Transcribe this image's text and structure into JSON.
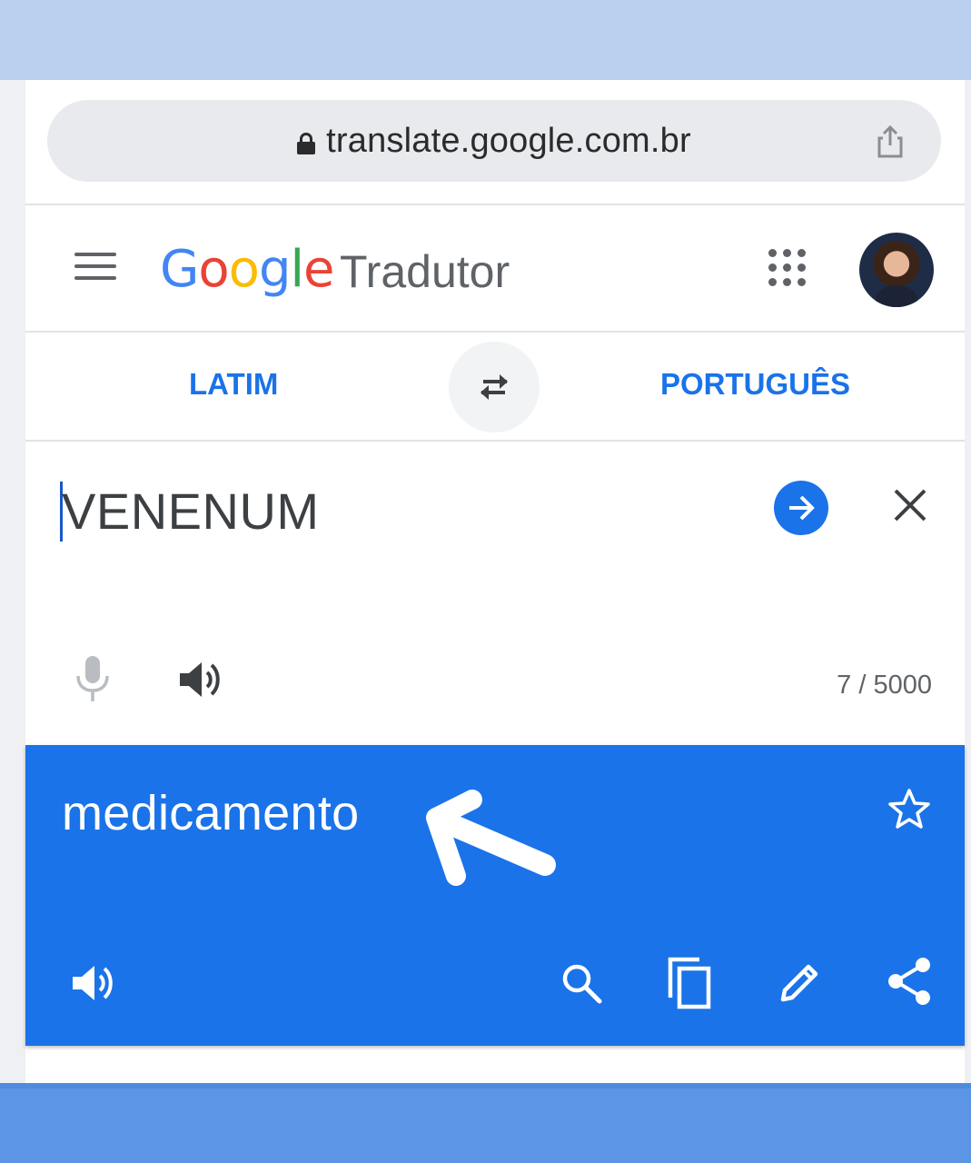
{
  "browser": {
    "url": "translate.google.com.br",
    "lock_icon": "lock-icon",
    "share_icon": "share-up-icon"
  },
  "header": {
    "logo": "Google",
    "product": "Tradutor",
    "menu_icon": "menu-icon",
    "apps_icon": "apps-grid-icon"
  },
  "languages": {
    "source": "LATIM",
    "target": "PORTUGUÊS",
    "swap_icon": "swap-arrows-icon"
  },
  "input": {
    "text": "VENENUM",
    "char_count": "7 / 5000"
  },
  "result": {
    "text": "medicamento"
  },
  "colors": {
    "accent": "#1a73e8",
    "top_band": "#b9cfee",
    "bottom_band": "#5b95e4",
    "icon_gray": "#5f6368"
  }
}
